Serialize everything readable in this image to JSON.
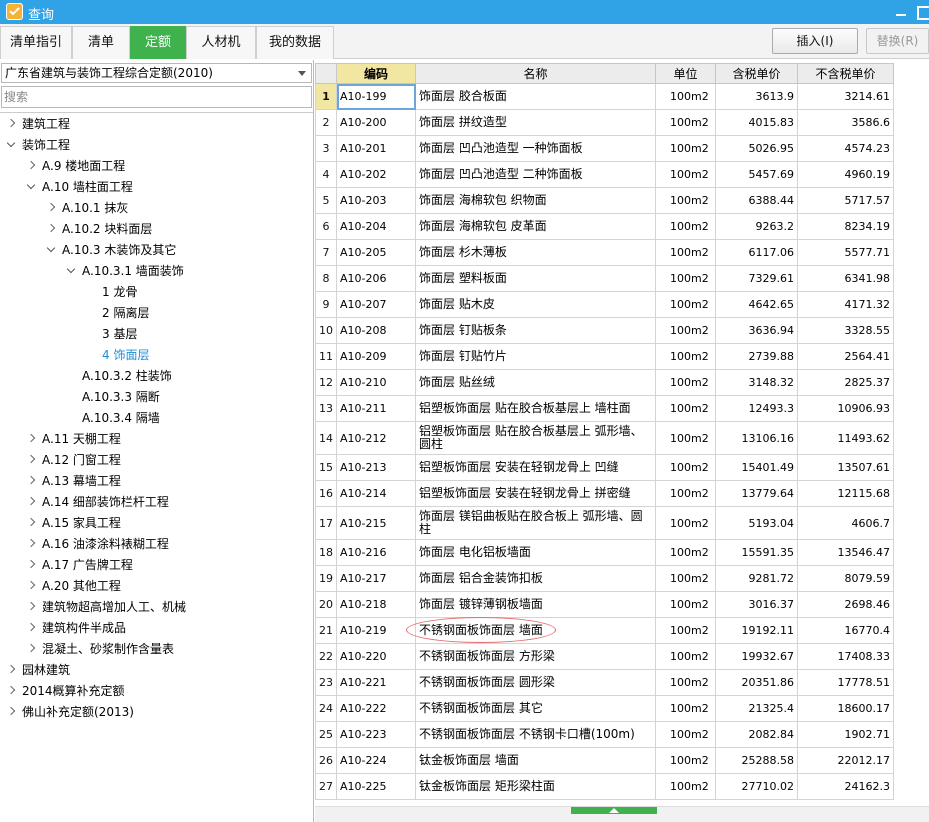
{
  "window": {
    "title": "查询"
  },
  "tabs": [
    {
      "label": "清单指引"
    },
    {
      "label": "清单"
    },
    {
      "label": "定额"
    },
    {
      "label": "人材机"
    },
    {
      "label": "我的数据"
    }
  ],
  "toolbar": {
    "insert_label": "插入(I)",
    "replace_label": "替换(R)"
  },
  "left": {
    "quota_book": "广东省建筑与装饰工程综合定额(2010)",
    "search_placeholder": "搜索"
  },
  "tree": [
    {
      "label": "建筑工程",
      "state": "collapsed"
    },
    {
      "label": "装饰工程",
      "state": "expanded"
    },
    {
      "label": "A.9 楼地面工程",
      "state": "collapsed"
    },
    {
      "label": "A.10 墙柱面工程",
      "state": "expanded"
    },
    {
      "label": "A.10.1 抹灰",
      "state": "collapsed"
    },
    {
      "label": "A.10.2 块料面层",
      "state": "collapsed"
    },
    {
      "label": "A.10.3 木装饰及其它",
      "state": "expanded"
    },
    {
      "label": "A.10.3.1 墙面装饰",
      "state": "expanded"
    },
    {
      "label": "1 龙骨",
      "state": "leaf"
    },
    {
      "label": "2 隔离层",
      "state": "leaf"
    },
    {
      "label": "3 基层",
      "state": "leaf"
    },
    {
      "label": "4 饰面层",
      "state": "leaf",
      "selected": true
    },
    {
      "label": "A.10.3.2 柱装饰",
      "state": "leaf"
    },
    {
      "label": "A.10.3.3 隔断",
      "state": "leaf"
    },
    {
      "label": "A.10.3.4 隔墙",
      "state": "leaf"
    },
    {
      "label": "A.11 天棚工程",
      "state": "collapsed"
    },
    {
      "label": "A.12 门窗工程",
      "state": "collapsed"
    },
    {
      "label": "A.13 幕墙工程",
      "state": "collapsed"
    },
    {
      "label": "A.14 细部装饰栏杆工程",
      "state": "collapsed"
    },
    {
      "label": "A.15 家具工程",
      "state": "collapsed"
    },
    {
      "label": "A.16 油漆涂料裱糊工程",
      "state": "collapsed"
    },
    {
      "label": "A.17 广告牌工程",
      "state": "collapsed"
    },
    {
      "label": "A.20 其他工程",
      "state": "collapsed"
    },
    {
      "label": "建筑物超高增加人工、机械",
      "state": "collapsed"
    },
    {
      "label": "建筑构件半成品",
      "state": "collapsed"
    },
    {
      "label": "混凝土、砂浆制作含量表",
      "state": "collapsed"
    },
    {
      "label": "园林建筑",
      "state": "collapsed"
    },
    {
      "label": "2014概算补充定额",
      "state": "collapsed"
    },
    {
      "label": "佛山补充定额(2013)",
      "state": "collapsed"
    }
  ],
  "table": {
    "columns": [
      "",
      "编码",
      "名称",
      "单位",
      "含税单价",
      "不含税单价"
    ],
    "rows": [
      {
        "no": "1",
        "code": "A10-199",
        "name": "饰面层 胶合板面",
        "unit": "100m2",
        "tax": "3613.9",
        "notax": "3214.61"
      },
      {
        "no": "2",
        "code": "A10-200",
        "name": "饰面层 拼纹造型",
        "unit": "100m2",
        "tax": "4015.83",
        "notax": "3586.6"
      },
      {
        "no": "3",
        "code": "A10-201",
        "name": "饰面层 凹凸池造型 一种饰面板",
        "unit": "100m2",
        "tax": "5026.95",
        "notax": "4574.23"
      },
      {
        "no": "4",
        "code": "A10-202",
        "name": "饰面层 凹凸池造型 二种饰面板",
        "unit": "100m2",
        "tax": "5457.69",
        "notax": "4960.19"
      },
      {
        "no": "5",
        "code": "A10-203",
        "name": "饰面层 海棉软包 织物面",
        "unit": "100m2",
        "tax": "6388.44",
        "notax": "5717.57"
      },
      {
        "no": "6",
        "code": "A10-204",
        "name": "饰面层 海棉软包 皮革面",
        "unit": "100m2",
        "tax": "9263.2",
        "notax": "8234.19"
      },
      {
        "no": "7",
        "code": "A10-205",
        "name": "饰面层 杉木薄板",
        "unit": "100m2",
        "tax": "6117.06",
        "notax": "5577.71"
      },
      {
        "no": "8",
        "code": "A10-206",
        "name": "饰面层 塑料板面",
        "unit": "100m2",
        "tax": "7329.61",
        "notax": "6341.98"
      },
      {
        "no": "9",
        "code": "A10-207",
        "name": "饰面层 贴木皮",
        "unit": "100m2",
        "tax": "4642.65",
        "notax": "4171.32"
      },
      {
        "no": "10",
        "code": "A10-208",
        "name": "饰面层 钉贴板条",
        "unit": "100m2",
        "tax": "3636.94",
        "notax": "3328.55"
      },
      {
        "no": "11",
        "code": "A10-209",
        "name": "饰面层 钉贴竹片",
        "unit": "100m2",
        "tax": "2739.88",
        "notax": "2564.41"
      },
      {
        "no": "12",
        "code": "A10-210",
        "name": "饰面层 贴丝绒",
        "unit": "100m2",
        "tax": "3148.32",
        "notax": "2825.37"
      },
      {
        "no": "13",
        "code": "A10-211",
        "name": "铝塑板饰面层 贴在胶合板基层上 墙柱面",
        "unit": "100m2",
        "tax": "12493.3",
        "notax": "10906.93"
      },
      {
        "no": "14",
        "code": "A10-212",
        "name": "铝塑板饰面层 贴在胶合板基层上 弧形墙、圆柱",
        "unit": "100m2",
        "tax": "13106.16",
        "notax": "11493.62"
      },
      {
        "no": "15",
        "code": "A10-213",
        "name": "铝塑板饰面层 安装在轻钢龙骨上 凹缝",
        "unit": "100m2",
        "tax": "15401.49",
        "notax": "13507.61"
      },
      {
        "no": "16",
        "code": "A10-214",
        "name": "铝塑板饰面层 安装在轻钢龙骨上 拼密缝",
        "unit": "100m2",
        "tax": "13779.64",
        "notax": "12115.68"
      },
      {
        "no": "17",
        "code": "A10-215",
        "name": "饰面层 镁铝曲板贴在胶合板上 弧形墙、圆柱",
        "unit": "100m2",
        "tax": "5193.04",
        "notax": "4606.7"
      },
      {
        "no": "18",
        "code": "A10-216",
        "name": "饰面层 电化铝板墙面",
        "unit": "100m2",
        "tax": "15591.35",
        "notax": "13546.47"
      },
      {
        "no": "19",
        "code": "A10-217",
        "name": "饰面层 铝合金装饰扣板",
        "unit": "100m2",
        "tax": "9281.72",
        "notax": "8079.59"
      },
      {
        "no": "20",
        "code": "A10-218",
        "name": "饰面层 镀锌薄钢板墙面",
        "unit": "100m2",
        "tax": "3016.37",
        "notax": "2698.46"
      },
      {
        "no": "21",
        "code": "A10-219",
        "name": "不锈钢面板饰面层 墙面",
        "unit": "100m2",
        "tax": "19192.11",
        "notax": "16770.4"
      },
      {
        "no": "22",
        "code": "A10-220",
        "name": "不锈钢面板饰面层 方形梁",
        "unit": "100m2",
        "tax": "19932.67",
        "notax": "17408.33"
      },
      {
        "no": "23",
        "code": "A10-221",
        "name": "不锈钢面板饰面层 圆形梁",
        "unit": "100m2",
        "tax": "20351.86",
        "notax": "17778.51"
      },
      {
        "no": "24",
        "code": "A10-222",
        "name": "不锈钢面板饰面层 其它",
        "unit": "100m2",
        "tax": "21325.4",
        "notax": "18600.17"
      },
      {
        "no": "25",
        "code": "A10-223",
        "name": "不锈钢面板饰面层 不锈钢卡口槽(100m)",
        "unit": "100m2",
        "tax": "2082.84",
        "notax": "1902.71"
      },
      {
        "no": "26",
        "code": "A10-224",
        "name": "钛金板饰面层 墙面",
        "unit": "100m2",
        "tax": "25288.58",
        "notax": "22012.17"
      },
      {
        "no": "27",
        "code": "A10-225",
        "name": "钛金板饰面层 矩形梁柱面",
        "unit": "100m2",
        "tax": "27710.02",
        "notax": "24162.3"
      }
    ]
  },
  "colors": {
    "titlebar": "#2fa3e6",
    "active_tab": "#3fb24d",
    "header_code": "#f2e6a3",
    "selected_tree": "#1e8fd6",
    "annotation": "#e46b6b"
  }
}
